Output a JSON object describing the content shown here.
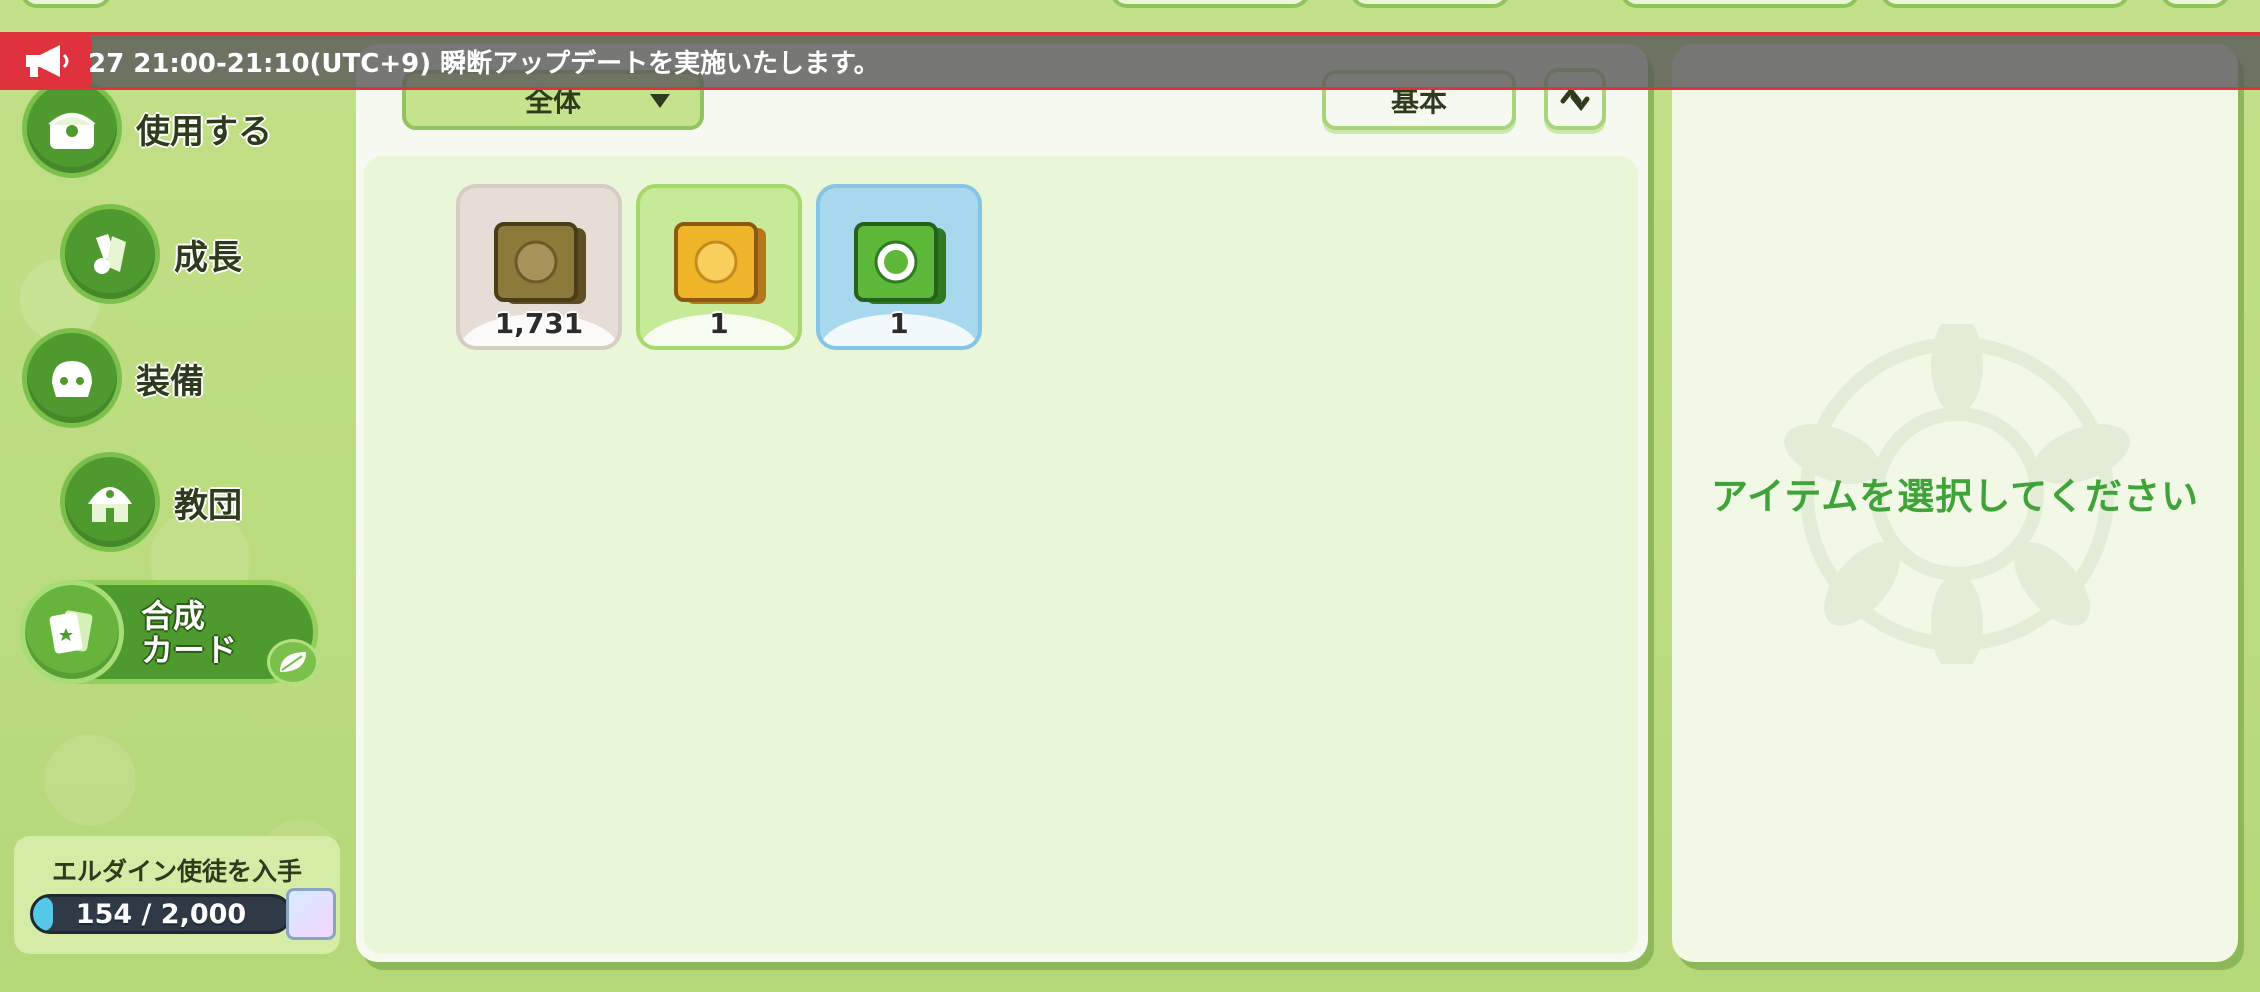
{
  "announcement": {
    "text": "27 21:00-21:10(UTC+9) 瞬断アップデートを実施いたします。"
  },
  "sidebar": {
    "items": [
      {
        "label": "使用する",
        "icon": "treasure-chest-icon"
      },
      {
        "label": "成長",
        "icon": "potion-icon"
      },
      {
        "label": "装備",
        "icon": "armor-icon"
      },
      {
        "label": "教団",
        "icon": "temple-icon"
      },
      {
        "label_line1": "合成",
        "label_line2": "カード",
        "icon": "card-icon",
        "active": true
      }
    ]
  },
  "progress": {
    "title": "エルダイン使徒を入手",
    "current": 154,
    "max": 2000,
    "label": "154 / 2,000"
  },
  "toolbar": {
    "filter_label": "全体",
    "sort_label": "基本"
  },
  "items": [
    {
      "count": "1,731",
      "color": "#8b7a3a",
      "frame": "#e6ddd6"
    },
    {
      "count": "1",
      "color": "#f0b429",
      "frame": "#c6ea98"
    },
    {
      "count": "1",
      "color": "#5db83a",
      "frame": "#a8d8ee"
    }
  ],
  "detail": {
    "empty_message": "アイテムを選択してください"
  },
  "colors": {
    "accent_green": "#4f9a2f",
    "banner_red": "#e0323c",
    "message_green": "#3fa33a"
  }
}
